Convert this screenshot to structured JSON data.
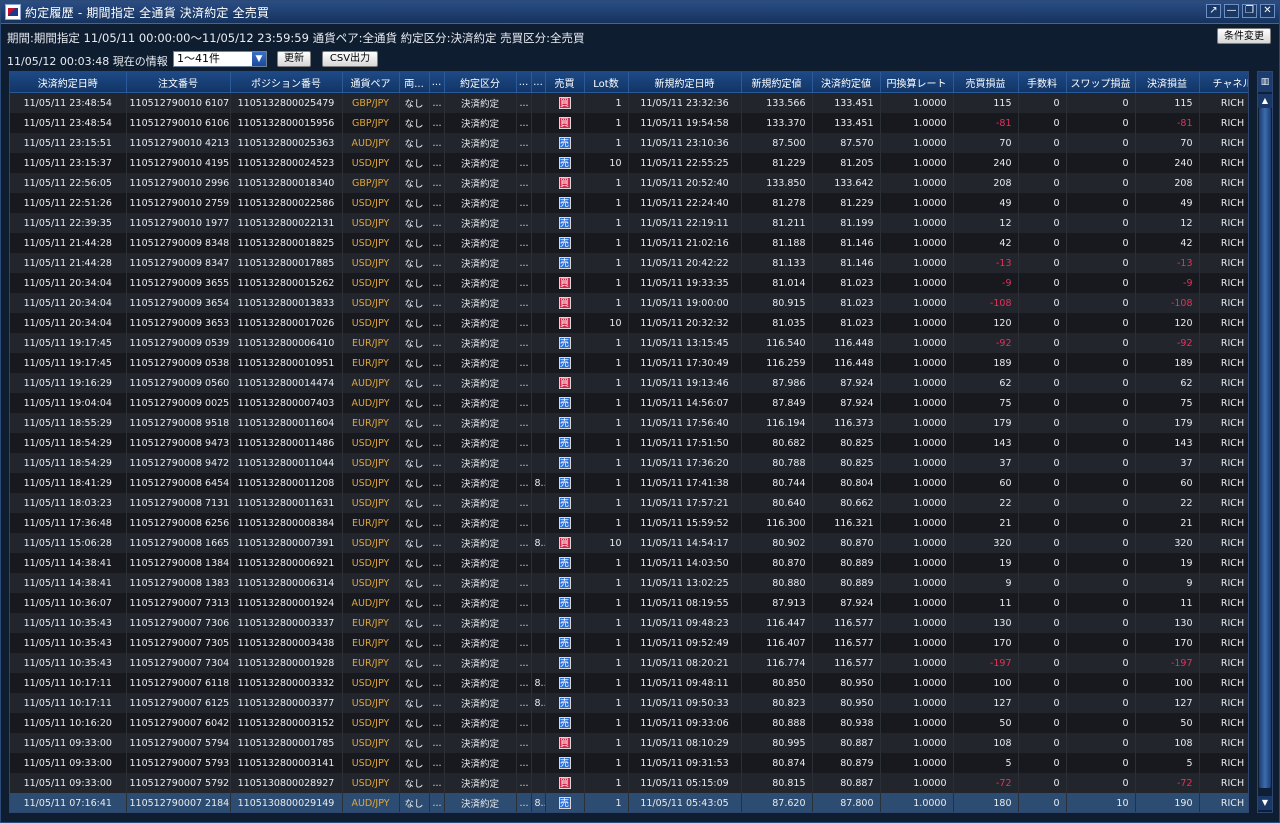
{
  "window": {
    "title": "約定履歴 - 期間指定 全通貨 決済約定 全売買",
    "controls": [
      "↗",
      "—",
      "❐",
      "✕"
    ]
  },
  "filter_line": "期間:期間指定  11/05/11 00:00:00～11/05/12 23:59:59   通貨ペア:全通貨   約定区分:決済約定   売買区分:全売買",
  "condition_button": "条件変更",
  "current_info": "11/05/12 00:03:48 現在の情報",
  "range_select": "1～41件",
  "refresh_button": "更新",
  "csv_button": "CSV出力",
  "columns": [
    "決済約定日時",
    "注文番号",
    "ポジション番号",
    "通貨ペア",
    "両...",
    "...",
    "約定区分",
    "...",
    "...",
    "売買",
    "Lot数",
    "新規約定日時",
    "新規約定値",
    "決済約定値",
    "円換算レート",
    "売買損益",
    "手数料",
    "スワップ損益",
    "決済損益",
    "チャネル"
  ],
  "column_icon": "▥",
  "side_labels": {
    "buy": "買",
    "sell": "売"
  },
  "rows": [
    {
      "close_time": "11/05/11 23:48:54",
      "order": "110512790010 6107",
      "position": "1105132800025479",
      "pair": "GBP/JPY",
      "both": "なし",
      "c5": "...",
      "kind": "決済約定",
      "c7": "...",
      "c8": "",
      "side": "buy",
      "lot": "1",
      "open_time": "11/05/11 23:32:36",
      "open_price": "133.566",
      "close_price": "133.451",
      "rate": "1.0000",
      "pl": "115",
      "fee": "0",
      "swap": "0",
      "settle": "115",
      "channel": "RICH"
    },
    {
      "close_time": "11/05/11 23:48:54",
      "order": "110512790010 6106",
      "position": "1105132800015956",
      "pair": "GBP/JPY",
      "both": "なし",
      "c5": "...",
      "kind": "決済約定",
      "c7": "...",
      "c8": "",
      "side": "buy",
      "lot": "1",
      "open_time": "11/05/11 19:54:58",
      "open_price": "133.370",
      "close_price": "133.451",
      "rate": "1.0000",
      "pl": "-81",
      "fee": "0",
      "swap": "0",
      "settle": "-81",
      "channel": "RICH"
    },
    {
      "close_time": "11/05/11 23:15:51",
      "order": "110512790010 4213",
      "position": "1105132800025363",
      "pair": "AUD/JPY",
      "both": "なし",
      "c5": "...",
      "kind": "決済約定",
      "c7": "...",
      "c8": "",
      "side": "sell",
      "lot": "1",
      "open_time": "11/05/11 23:10:36",
      "open_price": "87.500",
      "close_price": "87.570",
      "rate": "1.0000",
      "pl": "70",
      "fee": "0",
      "swap": "0",
      "settle": "70",
      "channel": "RICH"
    },
    {
      "close_time": "11/05/11 23:15:37",
      "order": "110512790010 4195",
      "position": "1105132800024523",
      "pair": "USD/JPY",
      "both": "なし",
      "c5": "...",
      "kind": "決済約定",
      "c7": "...",
      "c8": "",
      "side": "sell",
      "lot": "10",
      "open_time": "11/05/11 22:55:25",
      "open_price": "81.229",
      "close_price": "81.205",
      "rate": "1.0000",
      "pl": "240",
      "fee": "0",
      "swap": "0",
      "settle": "240",
      "channel": "RICH"
    },
    {
      "close_time": "11/05/11 22:56:05",
      "order": "110512790010 2996",
      "position": "1105132800018340",
      "pair": "GBP/JPY",
      "both": "なし",
      "c5": "...",
      "kind": "決済約定",
      "c7": "...",
      "c8": "",
      "side": "buy",
      "lot": "1",
      "open_time": "11/05/11 20:52:40",
      "open_price": "133.850",
      "close_price": "133.642",
      "rate": "1.0000",
      "pl": "208",
      "fee": "0",
      "swap": "0",
      "settle": "208",
      "channel": "RICH"
    },
    {
      "close_time": "11/05/11 22:51:26",
      "order": "110512790010 2759",
      "position": "1105132800022586",
      "pair": "USD/JPY",
      "both": "なし",
      "c5": "...",
      "kind": "決済約定",
      "c7": "...",
      "c8": "",
      "side": "sell",
      "lot": "1",
      "open_time": "11/05/11 22:24:40",
      "open_price": "81.278",
      "close_price": "81.229",
      "rate": "1.0000",
      "pl": "49",
      "fee": "0",
      "swap": "0",
      "settle": "49",
      "channel": "RICH"
    },
    {
      "close_time": "11/05/11 22:39:35",
      "order": "110512790010 1977",
      "position": "1105132800022131",
      "pair": "USD/JPY",
      "both": "なし",
      "c5": "...",
      "kind": "決済約定",
      "c7": "...",
      "c8": "",
      "side": "sell",
      "lot": "1",
      "open_time": "11/05/11 22:19:11",
      "open_price": "81.211",
      "close_price": "81.199",
      "rate": "1.0000",
      "pl": "12",
      "fee": "0",
      "swap": "0",
      "settle": "12",
      "channel": "RICH"
    },
    {
      "close_time": "11/05/11 21:44:28",
      "order": "110512790009 8348",
      "position": "1105132800018825",
      "pair": "USD/JPY",
      "both": "なし",
      "c5": "...",
      "kind": "決済約定",
      "c7": "...",
      "c8": "",
      "side": "sell",
      "lot": "1",
      "open_time": "11/05/11 21:02:16",
      "open_price": "81.188",
      "close_price": "81.146",
      "rate": "1.0000",
      "pl": "42",
      "fee": "0",
      "swap": "0",
      "settle": "42",
      "channel": "RICH"
    },
    {
      "close_time": "11/05/11 21:44:28",
      "order": "110512790009 8347",
      "position": "1105132800017885",
      "pair": "USD/JPY",
      "both": "なし",
      "c5": "...",
      "kind": "決済約定",
      "c7": "...",
      "c8": "",
      "side": "sell",
      "lot": "1",
      "open_time": "11/05/11 20:42:22",
      "open_price": "81.133",
      "close_price": "81.146",
      "rate": "1.0000",
      "pl": "-13",
      "fee": "0",
      "swap": "0",
      "settle": "-13",
      "channel": "RICH"
    },
    {
      "close_time": "11/05/11 20:34:04",
      "order": "110512790009 3655",
      "position": "1105132800015262",
      "pair": "USD/JPY",
      "both": "なし",
      "c5": "...",
      "kind": "決済約定",
      "c7": "...",
      "c8": "",
      "side": "buy",
      "lot": "1",
      "open_time": "11/05/11 19:33:35",
      "open_price": "81.014",
      "close_price": "81.023",
      "rate": "1.0000",
      "pl": "-9",
      "fee": "0",
      "swap": "0",
      "settle": "-9",
      "channel": "RICH"
    },
    {
      "close_time": "11/05/11 20:34:04",
      "order": "110512790009 3654",
      "position": "1105132800013833",
      "pair": "USD/JPY",
      "both": "なし",
      "c5": "...",
      "kind": "決済約定",
      "c7": "...",
      "c8": "",
      "side": "buy",
      "lot": "1",
      "open_time": "11/05/11 19:00:00",
      "open_price": "80.915",
      "close_price": "81.023",
      "rate": "1.0000",
      "pl": "-108",
      "fee": "0",
      "swap": "0",
      "settle": "-108",
      "channel": "RICH"
    },
    {
      "close_time": "11/05/11 20:34:04",
      "order": "110512790009 3653",
      "position": "1105132800017026",
      "pair": "USD/JPY",
      "both": "なし",
      "c5": "...",
      "kind": "決済約定",
      "c7": "...",
      "c8": "",
      "side": "buy",
      "lot": "10",
      "open_time": "11/05/11 20:32:32",
      "open_price": "81.035",
      "close_price": "81.023",
      "rate": "1.0000",
      "pl": "120",
      "fee": "0",
      "swap": "0",
      "settle": "120",
      "channel": "RICH"
    },
    {
      "close_time": "11/05/11 19:17:45",
      "order": "110512790009 0539",
      "position": "1105132800006410",
      "pair": "EUR/JPY",
      "both": "なし",
      "c5": "...",
      "kind": "決済約定",
      "c7": "...",
      "c8": "",
      "side": "sell",
      "lot": "1",
      "open_time": "11/05/11 13:15:45",
      "open_price": "116.540",
      "close_price": "116.448",
      "rate": "1.0000",
      "pl": "-92",
      "fee": "0",
      "swap": "0",
      "settle": "-92",
      "channel": "RICH"
    },
    {
      "close_time": "11/05/11 19:17:45",
      "order": "110512790009 0538",
      "position": "1105132800010951",
      "pair": "EUR/JPY",
      "both": "なし",
      "c5": "...",
      "kind": "決済約定",
      "c7": "...",
      "c8": "",
      "side": "sell",
      "lot": "1",
      "open_time": "11/05/11 17:30:49",
      "open_price": "116.259",
      "close_price": "116.448",
      "rate": "1.0000",
      "pl": "189",
      "fee": "0",
      "swap": "0",
      "settle": "189",
      "channel": "RICH"
    },
    {
      "close_time": "11/05/11 19:16:29",
      "order": "110512790009 0560",
      "position": "1105132800014474",
      "pair": "AUD/JPY",
      "both": "なし",
      "c5": "...",
      "kind": "決済約定",
      "c7": "...",
      "c8": "",
      "side": "buy",
      "lot": "1",
      "open_time": "11/05/11 19:13:46",
      "open_price": "87.986",
      "close_price": "87.924",
      "rate": "1.0000",
      "pl": "62",
      "fee": "0",
      "swap": "0",
      "settle": "62",
      "channel": "RICH"
    },
    {
      "close_time": "11/05/11 19:04:04",
      "order": "110512790009 0025",
      "position": "1105132800007403",
      "pair": "AUD/JPY",
      "both": "なし",
      "c5": "...",
      "kind": "決済約定",
      "c7": "...",
      "c8": "",
      "side": "sell",
      "lot": "1",
      "open_time": "11/05/11 14:56:07",
      "open_price": "87.849",
      "close_price": "87.924",
      "rate": "1.0000",
      "pl": "75",
      "fee": "0",
      "swap": "0",
      "settle": "75",
      "channel": "RICH"
    },
    {
      "close_time": "11/05/11 18:55:29",
      "order": "110512790008 9518",
      "position": "1105132800011604",
      "pair": "EUR/JPY",
      "both": "なし",
      "c5": "...",
      "kind": "決済約定",
      "c7": "...",
      "c8": "",
      "side": "sell",
      "lot": "1",
      "open_time": "11/05/11 17:56:40",
      "open_price": "116.194",
      "close_price": "116.373",
      "rate": "1.0000",
      "pl": "179",
      "fee": "0",
      "swap": "0",
      "settle": "179",
      "channel": "RICH"
    },
    {
      "close_time": "11/05/11 18:54:29",
      "order": "110512790008 9473",
      "position": "1105132800011486",
      "pair": "USD/JPY",
      "both": "なし",
      "c5": "...",
      "kind": "決済約定",
      "c7": "...",
      "c8": "",
      "side": "sell",
      "lot": "1",
      "open_time": "11/05/11 17:51:50",
      "open_price": "80.682",
      "close_price": "80.825",
      "rate": "1.0000",
      "pl": "143",
      "fee": "0",
      "swap": "0",
      "settle": "143",
      "channel": "RICH"
    },
    {
      "close_time": "11/05/11 18:54:29",
      "order": "110512790008 9472",
      "position": "1105132800011044",
      "pair": "USD/JPY",
      "both": "なし",
      "c5": "...",
      "kind": "決済約定",
      "c7": "...",
      "c8": "",
      "side": "sell",
      "lot": "1",
      "open_time": "11/05/11 17:36:20",
      "open_price": "80.788",
      "close_price": "80.825",
      "rate": "1.0000",
      "pl": "37",
      "fee": "0",
      "swap": "0",
      "settle": "37",
      "channel": "RICH"
    },
    {
      "close_time": "11/05/11 18:41:29",
      "order": "110512790008 6454",
      "position": "1105132800011208",
      "pair": "USD/JPY",
      "both": "なし",
      "c5": "...",
      "kind": "決済約定",
      "c7": "...",
      "c8": "8...",
      "side": "sell",
      "lot": "1",
      "open_time": "11/05/11 17:41:38",
      "open_price": "80.744",
      "close_price": "80.804",
      "rate": "1.0000",
      "pl": "60",
      "fee": "0",
      "swap": "0",
      "settle": "60",
      "channel": "RICH"
    },
    {
      "close_time": "11/05/11 18:03:23",
      "order": "110512790008 7131",
      "position": "1105132800011631",
      "pair": "USD/JPY",
      "both": "なし",
      "c5": "...",
      "kind": "決済約定",
      "c7": "...",
      "c8": "",
      "side": "sell",
      "lot": "1",
      "open_time": "11/05/11 17:57:21",
      "open_price": "80.640",
      "close_price": "80.662",
      "rate": "1.0000",
      "pl": "22",
      "fee": "0",
      "swap": "0",
      "settle": "22",
      "channel": "RICH"
    },
    {
      "close_time": "11/05/11 17:36:48",
      "order": "110512790008 6256",
      "position": "1105132800008384",
      "pair": "EUR/JPY",
      "both": "なし",
      "c5": "...",
      "kind": "決済約定",
      "c7": "...",
      "c8": "",
      "side": "sell",
      "lot": "1",
      "open_time": "11/05/11 15:59:52",
      "open_price": "116.300",
      "close_price": "116.321",
      "rate": "1.0000",
      "pl": "21",
      "fee": "0",
      "swap": "0",
      "settle": "21",
      "channel": "RICH"
    },
    {
      "close_time": "11/05/11 15:06:28",
      "order": "110512790008 1665",
      "position": "1105132800007391",
      "pair": "USD/JPY",
      "both": "なし",
      "c5": "...",
      "kind": "決済約定",
      "c7": "...",
      "c8": "8...",
      "side": "buy",
      "lot": "10",
      "open_time": "11/05/11 14:54:17",
      "open_price": "80.902",
      "close_price": "80.870",
      "rate": "1.0000",
      "pl": "320",
      "fee": "0",
      "swap": "0",
      "settle": "320",
      "channel": "RICH"
    },
    {
      "close_time": "11/05/11 14:38:41",
      "order": "110512790008 1384",
      "position": "1105132800006921",
      "pair": "USD/JPY",
      "both": "なし",
      "c5": "...",
      "kind": "決済約定",
      "c7": "...",
      "c8": "",
      "side": "sell",
      "lot": "1",
      "open_time": "11/05/11 14:03:50",
      "open_price": "80.870",
      "close_price": "80.889",
      "rate": "1.0000",
      "pl": "19",
      "fee": "0",
      "swap": "0",
      "settle": "19",
      "channel": "RICH"
    },
    {
      "close_time": "11/05/11 14:38:41",
      "order": "110512790008 1383",
      "position": "1105132800006314",
      "pair": "USD/JPY",
      "both": "なし",
      "c5": "...",
      "kind": "決済約定",
      "c7": "...",
      "c8": "",
      "side": "sell",
      "lot": "1",
      "open_time": "11/05/11 13:02:25",
      "open_price": "80.880",
      "close_price": "80.889",
      "rate": "1.0000",
      "pl": "9",
      "fee": "0",
      "swap": "0",
      "settle": "9",
      "channel": "RICH"
    },
    {
      "close_time": "11/05/11 10:36:07",
      "order": "110512790007 7313",
      "position": "1105132800001924",
      "pair": "AUD/JPY",
      "both": "なし",
      "c5": "...",
      "kind": "決済約定",
      "c7": "...",
      "c8": "",
      "side": "sell",
      "lot": "1",
      "open_time": "11/05/11 08:19:55",
      "open_price": "87.913",
      "close_price": "87.924",
      "rate": "1.0000",
      "pl": "11",
      "fee": "0",
      "swap": "0",
      "settle": "11",
      "channel": "RICH"
    },
    {
      "close_time": "11/05/11 10:35:43",
      "order": "110512790007 7306",
      "position": "1105132800003337",
      "pair": "EUR/JPY",
      "both": "なし",
      "c5": "...",
      "kind": "決済約定",
      "c7": "...",
      "c8": "",
      "side": "sell",
      "lot": "1",
      "open_time": "11/05/11 09:48:23",
      "open_price": "116.447",
      "close_price": "116.577",
      "rate": "1.0000",
      "pl": "130",
      "fee": "0",
      "swap": "0",
      "settle": "130",
      "channel": "RICH"
    },
    {
      "close_time": "11/05/11 10:35:43",
      "order": "110512790007 7305",
      "position": "1105132800003438",
      "pair": "EUR/JPY",
      "both": "なし",
      "c5": "...",
      "kind": "決済約定",
      "c7": "...",
      "c8": "",
      "side": "sell",
      "lot": "1",
      "open_time": "11/05/11 09:52:49",
      "open_price": "116.407",
      "close_price": "116.577",
      "rate": "1.0000",
      "pl": "170",
      "fee": "0",
      "swap": "0",
      "settle": "170",
      "channel": "RICH"
    },
    {
      "close_time": "11/05/11 10:35:43",
      "order": "110512790007 7304",
      "position": "1105132800001928",
      "pair": "EUR/JPY",
      "both": "なし",
      "c5": "...",
      "kind": "決済約定",
      "c7": "...",
      "c8": "",
      "side": "sell",
      "lot": "1",
      "open_time": "11/05/11 08:20:21",
      "open_price": "116.774",
      "close_price": "116.577",
      "rate": "1.0000",
      "pl": "-197",
      "fee": "0",
      "swap": "0",
      "settle": "-197",
      "channel": "RICH"
    },
    {
      "close_time": "11/05/11 10:17:11",
      "order": "110512790007 6118",
      "position": "1105132800003332",
      "pair": "USD/JPY",
      "both": "なし",
      "c5": "...",
      "kind": "決済約定",
      "c7": "...",
      "c8": "8...",
      "side": "sell",
      "lot": "1",
      "open_time": "11/05/11 09:48:11",
      "open_price": "80.850",
      "close_price": "80.950",
      "rate": "1.0000",
      "pl": "100",
      "fee": "0",
      "swap": "0",
      "settle": "100",
      "channel": "RICH"
    },
    {
      "close_time": "11/05/11 10:17:11",
      "order": "110512790007 6125",
      "position": "1105132800003377",
      "pair": "USD/JPY",
      "both": "なし",
      "c5": "...",
      "kind": "決済約定",
      "c7": "...",
      "c8": "8...",
      "side": "sell",
      "lot": "1",
      "open_time": "11/05/11 09:50:33",
      "open_price": "80.823",
      "close_price": "80.950",
      "rate": "1.0000",
      "pl": "127",
      "fee": "0",
      "swap": "0",
      "settle": "127",
      "channel": "RICH"
    },
    {
      "close_time": "11/05/11 10:16:20",
      "order": "110512790007 6042",
      "position": "1105132800003152",
      "pair": "USD/JPY",
      "both": "なし",
      "c5": "...",
      "kind": "決済約定",
      "c7": "...",
      "c8": "",
      "side": "sell",
      "lot": "1",
      "open_time": "11/05/11 09:33:06",
      "open_price": "80.888",
      "close_price": "80.938",
      "rate": "1.0000",
      "pl": "50",
      "fee": "0",
      "swap": "0",
      "settle": "50",
      "channel": "RICH"
    },
    {
      "close_time": "11/05/11 09:33:00",
      "order": "110512790007 5794",
      "position": "1105132800001785",
      "pair": "USD/JPY",
      "both": "なし",
      "c5": "...",
      "kind": "決済約定",
      "c7": "...",
      "c8": "",
      "side": "buy",
      "lot": "1",
      "open_time": "11/05/11 08:10:29",
      "open_price": "80.995",
      "close_price": "80.887",
      "rate": "1.0000",
      "pl": "108",
      "fee": "0",
      "swap": "0",
      "settle": "108",
      "channel": "RICH"
    },
    {
      "close_time": "11/05/11 09:33:00",
      "order": "110512790007 5793",
      "position": "1105132800003141",
      "pair": "USD/JPY",
      "both": "なし",
      "c5": "...",
      "kind": "決済約定",
      "c7": "...",
      "c8": "",
      "side": "sell",
      "lot": "1",
      "open_time": "11/05/11 09:31:53",
      "open_price": "80.874",
      "close_price": "80.879",
      "rate": "1.0000",
      "pl": "5",
      "fee": "0",
      "swap": "0",
      "settle": "5",
      "channel": "RICH"
    },
    {
      "close_time": "11/05/11 09:33:00",
      "order": "110512790007 5792",
      "position": "1105130800028927",
      "pair": "USD/JPY",
      "both": "なし",
      "c5": "...",
      "kind": "決済約定",
      "c7": "...",
      "c8": "",
      "side": "buy",
      "lot": "1",
      "open_time": "11/05/11 05:15:09",
      "open_price": "80.815",
      "close_price": "80.887",
      "rate": "1.0000",
      "pl": "-72",
      "fee": "0",
      "swap": "0",
      "settle": "-72",
      "channel": "RICH"
    },
    {
      "close_time": "11/05/11 07:16:41",
      "order": "110512790007 2184",
      "position": "1105130800029149",
      "pair": "AUD/JPY",
      "both": "なし",
      "c5": "...",
      "kind": "決済約定",
      "c7": "...",
      "c8": "8...",
      "side": "sell",
      "lot": "1",
      "open_time": "11/05/11 05:43:05",
      "open_price": "87.620",
      "close_price": "87.800",
      "rate": "1.0000",
      "pl": "180",
      "fee": "0",
      "swap": "10",
      "settle": "190",
      "channel": "RICH",
      "selected": true
    }
  ],
  "colors": {
    "accent": "#1e4a86",
    "buy": "#d2264a",
    "sell": "#2a6fd6",
    "negative": "#e8305a",
    "pair": "#e0a63c"
  }
}
